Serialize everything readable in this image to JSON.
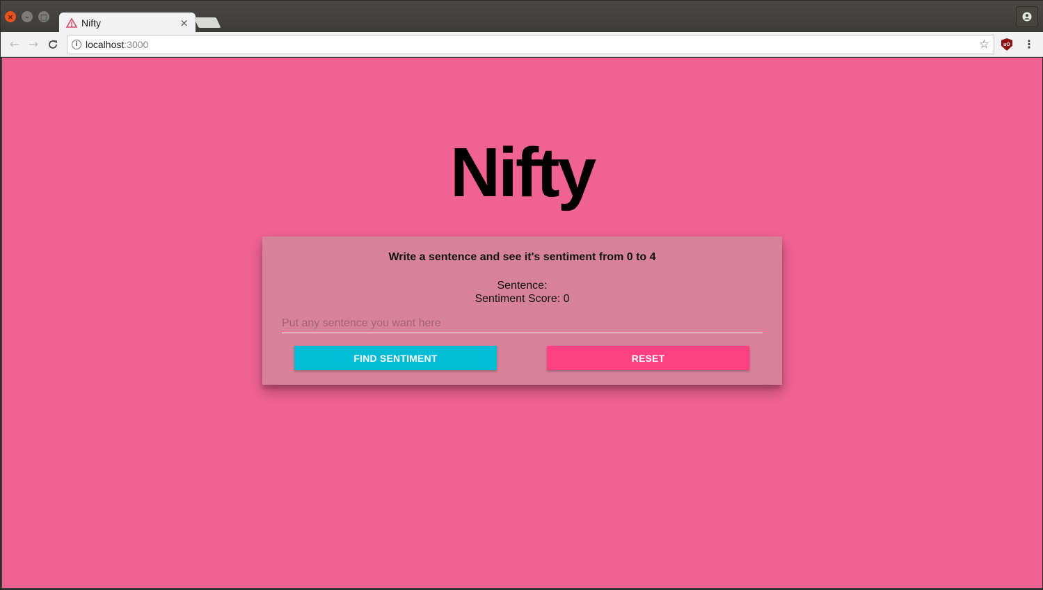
{
  "browser": {
    "tab_title": "Nifty",
    "tab_close": "×",
    "url_host": "localhost",
    "url_port": ":3000",
    "icons": {
      "back": "back-arrow-icon",
      "forward": "forward-arrow-icon",
      "reload": "reload-icon",
      "info": "info-icon",
      "star": "bookmark-star-icon",
      "extension": "ublock-shield-icon",
      "menu": "kebab-menu-icon",
      "profile": "profile-icon"
    }
  },
  "app": {
    "title": "Nifty",
    "background_color": "#f06292",
    "card": {
      "heading": "Write a sentence and see it's sentiment from 0 to 4",
      "sentence_label": "Sentence:",
      "score_label": "Sentiment Score: 0",
      "input_placeholder": "Put any sentence you want here",
      "input_value": "",
      "find_button": "FIND SENTIMENT",
      "reset_button": "RESET",
      "colors": {
        "card_bg": "#d6829b",
        "find_button": "#00bcd4",
        "reset_button": "#ff4081"
      }
    }
  }
}
